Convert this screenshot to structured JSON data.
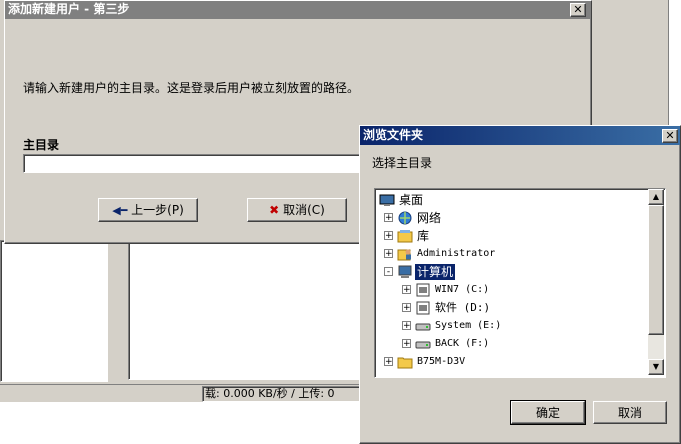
{
  "wizard": {
    "title": "添加新建用户 - 第三步",
    "instruction": "请输入新建用户的主目录。这是登录后用户被立刻放置的路径。",
    "home_label": "主目录",
    "home_value": "",
    "back_label": "上一步(P)",
    "cancel_label": "取消(C)"
  },
  "status_bar": {
    "text": "载: 0.000 KB/秒 / 上传: 0"
  },
  "browse": {
    "title": "浏览文件夹",
    "prompt": "选择主目录",
    "ok_label": "确定",
    "cancel_label": "取消",
    "tree": [
      {
        "label": "桌面",
        "icon": "desktop-icon",
        "level": 0,
        "expander": ""
      },
      {
        "label": "网络",
        "icon": "network-icon",
        "level": 1,
        "expander": "+"
      },
      {
        "label": "库",
        "icon": "library-icon",
        "level": 1,
        "expander": "+"
      },
      {
        "label": "Administrator",
        "icon": "user-folder-icon",
        "level": 1,
        "expander": "+"
      },
      {
        "label": "计算机",
        "icon": "computer-icon",
        "level": 1,
        "expander": "-",
        "selected": true
      },
      {
        "label": "WIN7 (C:)",
        "icon": "drive-icon",
        "level": 2,
        "expander": "+"
      },
      {
        "label": "软件 (D:)",
        "icon": "drive-icon",
        "level": 2,
        "expander": "+"
      },
      {
        "label": "System (E:)",
        "icon": "removable-drive-icon",
        "level": 2,
        "expander": "+"
      },
      {
        "label": "BACK (F:)",
        "icon": "removable-drive-icon",
        "level": 2,
        "expander": "+"
      },
      {
        "label": "B75M-D3V",
        "icon": "folder-icon",
        "level": 1,
        "expander": "+"
      }
    ]
  },
  "colors": {
    "dialog_bg": "#d4d0c8",
    "active_title": "#0a246a",
    "inactive_title": "#808080",
    "selection": "#0a246a"
  }
}
